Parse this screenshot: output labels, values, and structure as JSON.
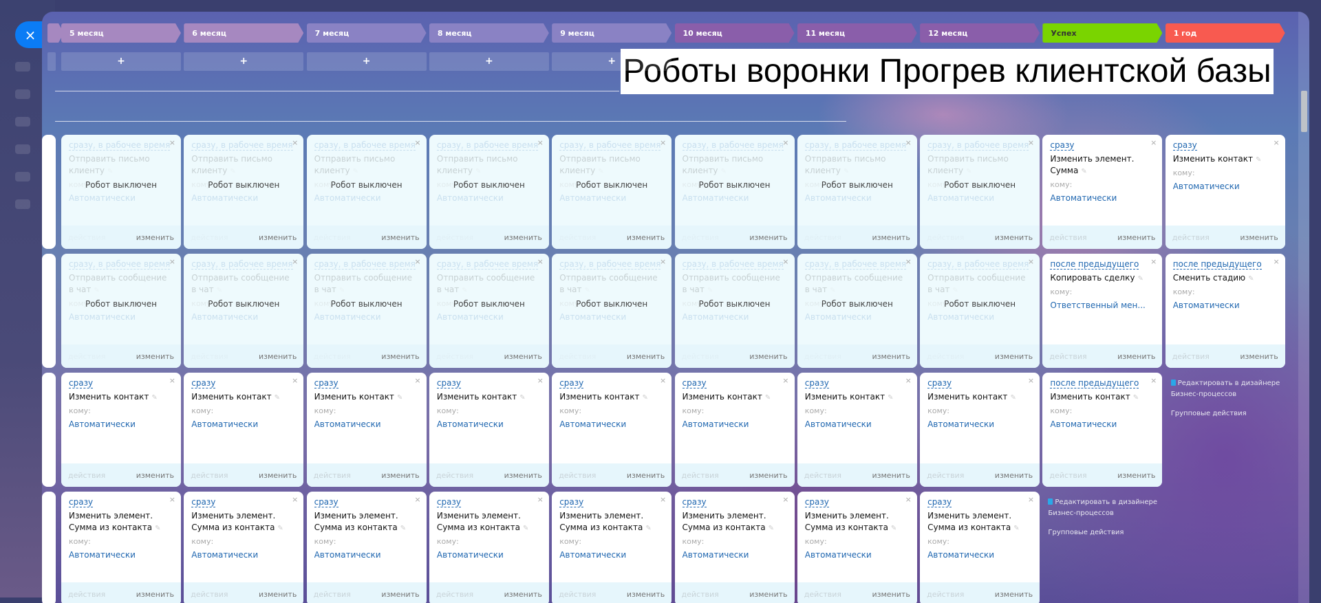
{
  "close_label": "×",
  "title": "Роботы воронки Прогрев клиентской базы",
  "add_label": "+",
  "stages": [
    {
      "label": "5 месяц",
      "color": "#a688c0",
      "text": "#fff"
    },
    {
      "label": "6 месяц",
      "color": "#a688c0",
      "text": "#fff"
    },
    {
      "label": "7 месяц",
      "color": "#8a82c4",
      "text": "#fff"
    },
    {
      "label": "8 месяц",
      "color": "#8a82c4",
      "text": "#fff"
    },
    {
      "label": "9 месяц",
      "color": "#8a82c4",
      "text": "#fff"
    },
    {
      "label": "10 месяц",
      "color": "#8a5eaa",
      "text": "#fff"
    },
    {
      "label": "11 месяц",
      "color": "#8a5eaa",
      "text": "#fff"
    },
    {
      "label": "12 месяц",
      "color": "#8a5eaa",
      "text": "#fff"
    },
    {
      "label": "Успех",
      "color": "#7ad400",
      "text": "#333"
    },
    {
      "label": "1 год",
      "color": "#f85a50",
      "text": "#fff"
    }
  ],
  "common": {
    "to_label": "кому:",
    "actions_label": "действия",
    "edit_label": "изменить",
    "disabled_label": "Робот выключен",
    "close_icon": "×"
  },
  "rows": [
    {
      "cards": [
        {
          "off": true,
          "delay": "сразу, в рабочее время",
          "name": "Отправить письмо клиенту",
          "to": "Автоматически"
        },
        {
          "off": true,
          "delay": "сразу, в рабочее время",
          "name": "Отправить письмо клиенту",
          "to": "Автоматически"
        },
        {
          "off": true,
          "delay": "сразу, в рабочее время",
          "name": "Отправить письмо клиенту",
          "to": "Автоматически"
        },
        {
          "off": true,
          "delay": "сразу, в рабочее время",
          "name": "Отправить письмо клиенту",
          "to": "Автоматически"
        },
        {
          "off": true,
          "delay": "сразу, в рабочее время",
          "name": "Отправить письмо клиенту",
          "to": "Автоматически"
        },
        {
          "off": true,
          "delay": "сразу, в рабочее время",
          "name": "Отправить письмо клиенту",
          "to": "Автоматически"
        },
        {
          "off": true,
          "delay": "сразу, в рабочее время",
          "name": "Отправить письмо клиенту",
          "to": "Автоматически"
        },
        {
          "off": true,
          "delay": "сразу, в рабочее время",
          "name": "Отправить письмо клиенту",
          "to": "Автоматически"
        },
        {
          "off": false,
          "delay": "сразу",
          "name": "Изменить элемент. Сумма",
          "to": "Автоматически"
        },
        {
          "off": false,
          "delay": "сразу",
          "name": "Изменить контакт",
          "to": "Автоматически"
        }
      ]
    },
    {
      "cards": [
        {
          "off": true,
          "delay": "сразу, в рабочее время",
          "name": "Отправить сообщение в чат",
          "to": "Автоматически"
        },
        {
          "off": true,
          "delay": "сразу, в рабочее время",
          "name": "Отправить сообщение в чат",
          "to": "Автоматически"
        },
        {
          "off": true,
          "delay": "сразу, в рабочее время",
          "name": "Отправить сообщение в чат",
          "to": "Автоматически"
        },
        {
          "off": true,
          "delay": "сразу, в рабочее время",
          "name": "Отправить сообщение в чат",
          "to": "Автоматически"
        },
        {
          "off": true,
          "delay": "сразу, в рабочее время",
          "name": "Отправить сообщение в чат",
          "to": "Автоматически"
        },
        {
          "off": true,
          "delay": "сразу, в рабочее время",
          "name": "Отправить сообщение в чат",
          "to": "Автоматически"
        },
        {
          "off": true,
          "delay": "сразу, в рабочее время",
          "name": "Отправить сообщение в чат",
          "to": "Автоматически"
        },
        {
          "off": true,
          "delay": "сразу, в рабочее время",
          "name": "Отправить сообщение в чат",
          "to": "Автоматически"
        },
        {
          "off": false,
          "delay": "после предыдущего",
          "name": "Копировать сделку",
          "to": "Ответственный мен..."
        },
        {
          "off": false,
          "delay": "после предыдущего",
          "name": "Сменить стадию",
          "to": "Автоматически"
        }
      ]
    },
    {
      "cards": [
        {
          "off": false,
          "delay": "сразу",
          "name": "Изменить контакт",
          "to": "Автоматически"
        },
        {
          "off": false,
          "delay": "сразу",
          "name": "Изменить контакт",
          "to": "Автоматически"
        },
        {
          "off": false,
          "delay": "сразу",
          "name": "Изменить контакт",
          "to": "Автоматически"
        },
        {
          "off": false,
          "delay": "сразу",
          "name": "Изменить контакт",
          "to": "Автоматически"
        },
        {
          "off": false,
          "delay": "сразу",
          "name": "Изменить контакт",
          "to": "Автоматически"
        },
        {
          "off": false,
          "delay": "сразу",
          "name": "Изменить контакт",
          "to": "Автоматически"
        },
        {
          "off": false,
          "delay": "сразу",
          "name": "Изменить контакт",
          "to": "Автоматически"
        },
        {
          "off": false,
          "delay": "сразу",
          "name": "Изменить контакт",
          "to": "Автоматически"
        },
        {
          "off": false,
          "delay": "после предыдущего",
          "name": "Изменить контакт",
          "to": "Автоматически"
        }
      ]
    },
    {
      "cards": [
        {
          "off": false,
          "delay": "сразу",
          "name": "Изменить элемент. Сумма из контакта",
          "to": "Автоматически"
        },
        {
          "off": false,
          "delay": "сразу",
          "name": "Изменить элемент. Сумма из контакта",
          "to": "Автоматически"
        },
        {
          "off": false,
          "delay": "сразу",
          "name": "Изменить элемент. Сумма из контакта",
          "to": "Автоматически"
        },
        {
          "off": false,
          "delay": "сразу",
          "name": "Изменить элемент. Сумма из контакта",
          "to": "Автоматически"
        },
        {
          "off": false,
          "delay": "сразу",
          "name": "Изменить элемент. Сумма из контакта",
          "to": "Автоматически"
        },
        {
          "off": false,
          "delay": "сразу",
          "name": "Изменить элемент. Сумма из контакта",
          "to": "Автоматически"
        },
        {
          "off": false,
          "delay": "сразу",
          "name": "Изменить элемент. Сумма из контакта",
          "to": "Автоматически"
        },
        {
          "off": false,
          "delay": "сразу",
          "name": "Изменить элемент. Сумма из контакта",
          "to": "Автоматически"
        }
      ]
    }
  ],
  "links": {
    "designer": "Редактировать в дизайнере Бизнес-процессов",
    "group": "Групповые действия"
  }
}
